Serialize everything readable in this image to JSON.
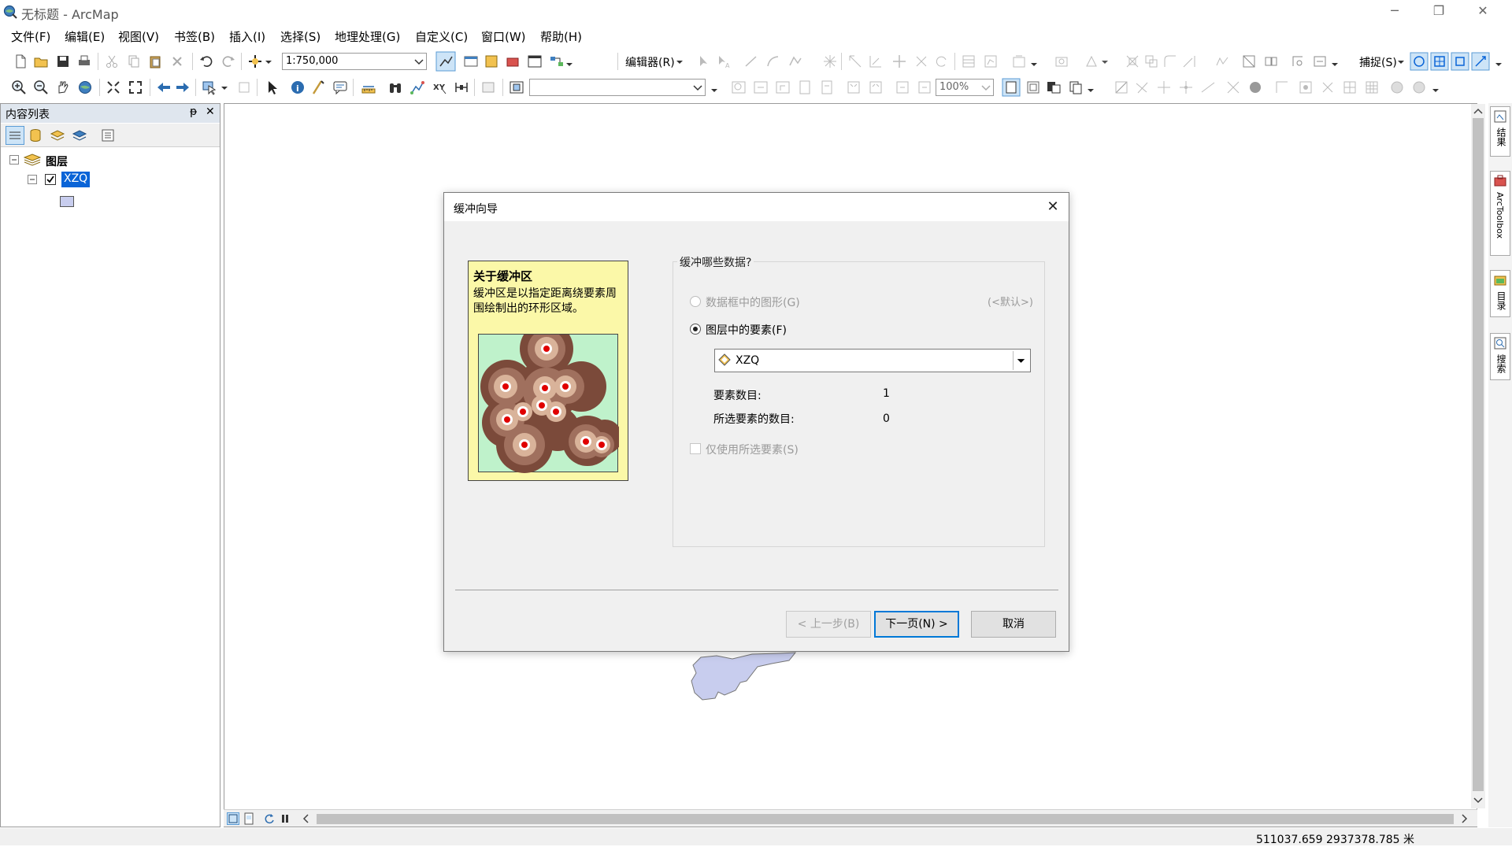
{
  "window": {
    "title": "无标题 - ArcMap",
    "controls": {
      "minimize": "─",
      "restore": "❐",
      "close": "✕"
    }
  },
  "menubar": {
    "items": [
      "文件(F)",
      "编辑(E)",
      "视图(V)",
      "书签(B)",
      "插入(I)",
      "选择(S)",
      "地理处理(G)",
      "自定义(C)",
      "窗口(W)",
      "帮助(H)"
    ]
  },
  "toolbar1": {
    "scale_value": "1:750,000",
    "editor_label": "编辑器(R)",
    "snapping_label": "捕捉(S)"
  },
  "toolbar2": {
    "zoom_value": "100%"
  },
  "toc": {
    "title": "内容列表",
    "pin": "ᵽ",
    "close": "✕",
    "root_label": "图层",
    "layer_label": "XZQ"
  },
  "dialog": {
    "title": "缓冲向导",
    "close_symbol": "✕",
    "info_heading": "关于缓冲区",
    "info_body": "缓冲区是以指定距离绕要素周围绘制出的环形区域。",
    "question": "缓冲哪些数据?",
    "option_graphics": "数据框中的图形(G)",
    "default_hint": "(<默认>)",
    "option_layer": "图层中的要素(F)",
    "selected_layer": "XZQ",
    "feature_count_label": "要素数目:",
    "feature_count_value": "1",
    "selected_count_label": "所选要素的数目:",
    "selected_count_value": "0",
    "use_selected_label": "仅使用所选要素(S)",
    "btn_back": "< 上一步(B)",
    "btn_next": "下一页(N) >",
    "btn_cancel": "取消"
  },
  "right_dock": {
    "tabs": [
      "结果",
      "ArcToolbox",
      "目录",
      "搜索"
    ]
  },
  "statusbar": {
    "coordinates": "511037.659  2937378.785 米"
  },
  "colors": {
    "accent": "#0078d7",
    "selection": "#0a64d7",
    "info_card_bg": "#fbf8a8",
    "buffer_green": "#bff2cb",
    "polygon_fill": "#c8cdee"
  }
}
